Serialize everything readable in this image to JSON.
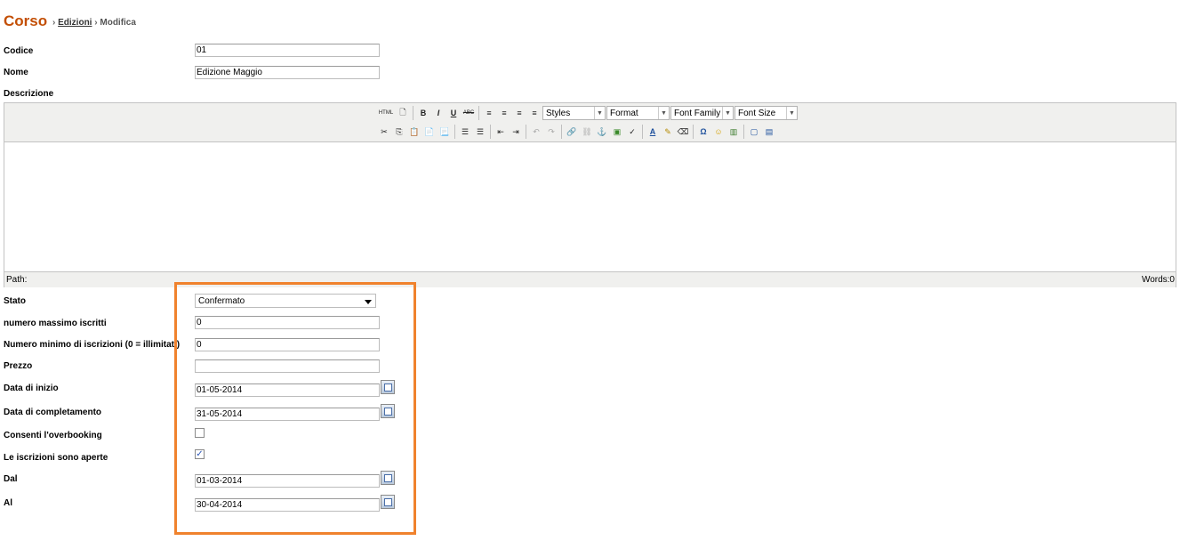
{
  "header": {
    "title": "Corso",
    "breadcrumb": [
      {
        "label": "Edizioni",
        "link": true
      },
      {
        "label": "Modifica",
        "link": false
      }
    ],
    "separator": "›"
  },
  "form": {
    "codice": {
      "label": "Codice",
      "value": "01"
    },
    "nome": {
      "label": "Nome",
      "value": "Edizione Maggio"
    },
    "descrizione": {
      "label": "Descrizione"
    },
    "stato": {
      "label": "Stato",
      "value": "Confermato"
    },
    "max_iscritti": {
      "label": "numero massimo iscritti",
      "value": "0"
    },
    "min_iscrizioni": {
      "label": "Numero minimo di iscrizioni (0 = illimitati)",
      "value": "0"
    },
    "prezzo": {
      "label": "Prezzo",
      "value": ""
    },
    "data_inizio": {
      "label": "Data di inizio",
      "value": "01-05-2014"
    },
    "data_completamento": {
      "label": "Data di completamento",
      "value": "31-05-2014"
    },
    "overbooking": {
      "label": "Consenti l'overbooking",
      "checked": false
    },
    "iscrizioni_aperte": {
      "label": "Le iscrizioni sono aperte",
      "checked": true
    },
    "dal": {
      "label": "Dal",
      "value": "01-03-2014"
    },
    "al": {
      "label": "Al",
      "value": "30-04-2014"
    }
  },
  "editor": {
    "toolbar_selects": {
      "styles": "Styles",
      "format": "Format",
      "font_family": "Font Family",
      "font_size": "Font Size"
    },
    "status": {
      "path": "Path:",
      "words": "Words:0"
    }
  },
  "colors": {
    "title": "#c34f05",
    "highlight": "#f0822d",
    "toolbar_bg": "#f0f0ee"
  }
}
